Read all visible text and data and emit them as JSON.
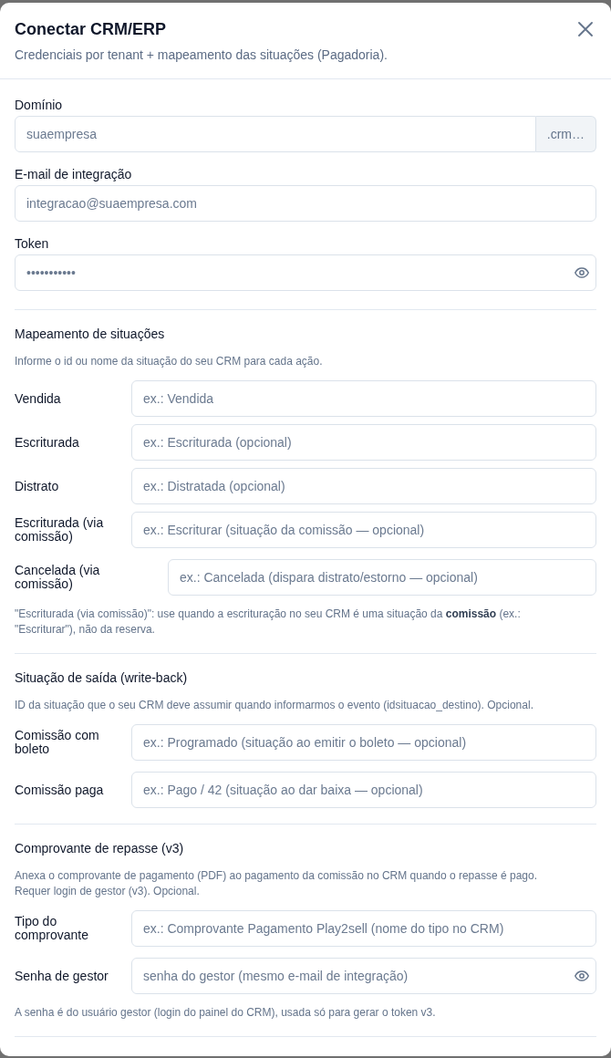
{
  "dialog": {
    "title": "Conectar CRM/ERP",
    "description": "Credenciais por tenant + mapeamento das situações (Pagadoria)."
  },
  "credentials": [
    {
      "kind": "addon",
      "label": "Domínio",
      "placeholder": "suaempresa",
      "addon": ".crm…"
    },
    {
      "kind": "text",
      "label": "E-mail de integração",
      "placeholder": "integracao@suaempresa.com"
    },
    {
      "kind": "password",
      "label": "Token",
      "placeholder": "•••••••••••"
    }
  ],
  "mapping": {
    "title": "Mapeamento de situações",
    "description": "Informe o id ou nome da situação do seu CRM para cada ação.",
    "rows": [
      {
        "kind": "text",
        "label": "Vendida",
        "placeholder": "ex.: Vendida"
      },
      {
        "kind": "text",
        "label": "Escriturada",
        "placeholder": "ex.: Escriturada (opcional)"
      },
      {
        "kind": "text",
        "label": "Distrato",
        "placeholder": "ex.: Distratada (opcional)"
      },
      {
        "kind": "text",
        "label": "Escriturada (via comissão)",
        "placeholder": "ex.: Escriturar (situação da comissão — opcional)"
      },
      {
        "kind": "wide",
        "label": "Cancelada (via comissão)",
        "placeholder": "ex.: Cancelada (dispara distrato/estorno — opcional)"
      }
    ],
    "note": "\"Escriturada (via comissão)\": use quando a escrituração no seu CRM é uma situação da **comissão** (ex.: \"Escriturar\"), não da reserva."
  },
  "write_back": {
    "title": "Situação de saída (write-back)",
    "description": "ID da situação que o seu CRM deve assumir quando informarmos o evento (idsituacao_destino). Opcional.",
    "rows": [
      {
        "kind": "text",
        "label": "Comissão com boleto",
        "placeholder": "ex.: Programado (situação ao emitir o boleto — opcional)"
      },
      {
        "kind": "text",
        "label": "Comissão paga",
        "placeholder": "ex.: Pago / 42 (situação ao dar baixa — opcional)"
      }
    ]
  },
  "receipt": {
    "title": "Comprovante de repasse (v3)",
    "description": "Anexa o comprovante de pagamento (PDF) ao pagamento da comissão no CRM quando o repasse é pago. Requer login de gestor (v3). Opcional.",
    "rows": [
      {
        "kind": "text",
        "label": "Tipo do comprovante",
        "placeholder": "ex.: Comprovante Pagamento Play2sell (nome do tipo no CRM)"
      },
      {
        "kind": "password",
        "label": "Senha de gestor",
        "placeholder": "senha do gestor (mesmo e-mail de integração)"
      }
    ],
    "note": "A senha é do usuário gestor (login do painel do CRM), usada só para gerar o token v3."
  }
}
